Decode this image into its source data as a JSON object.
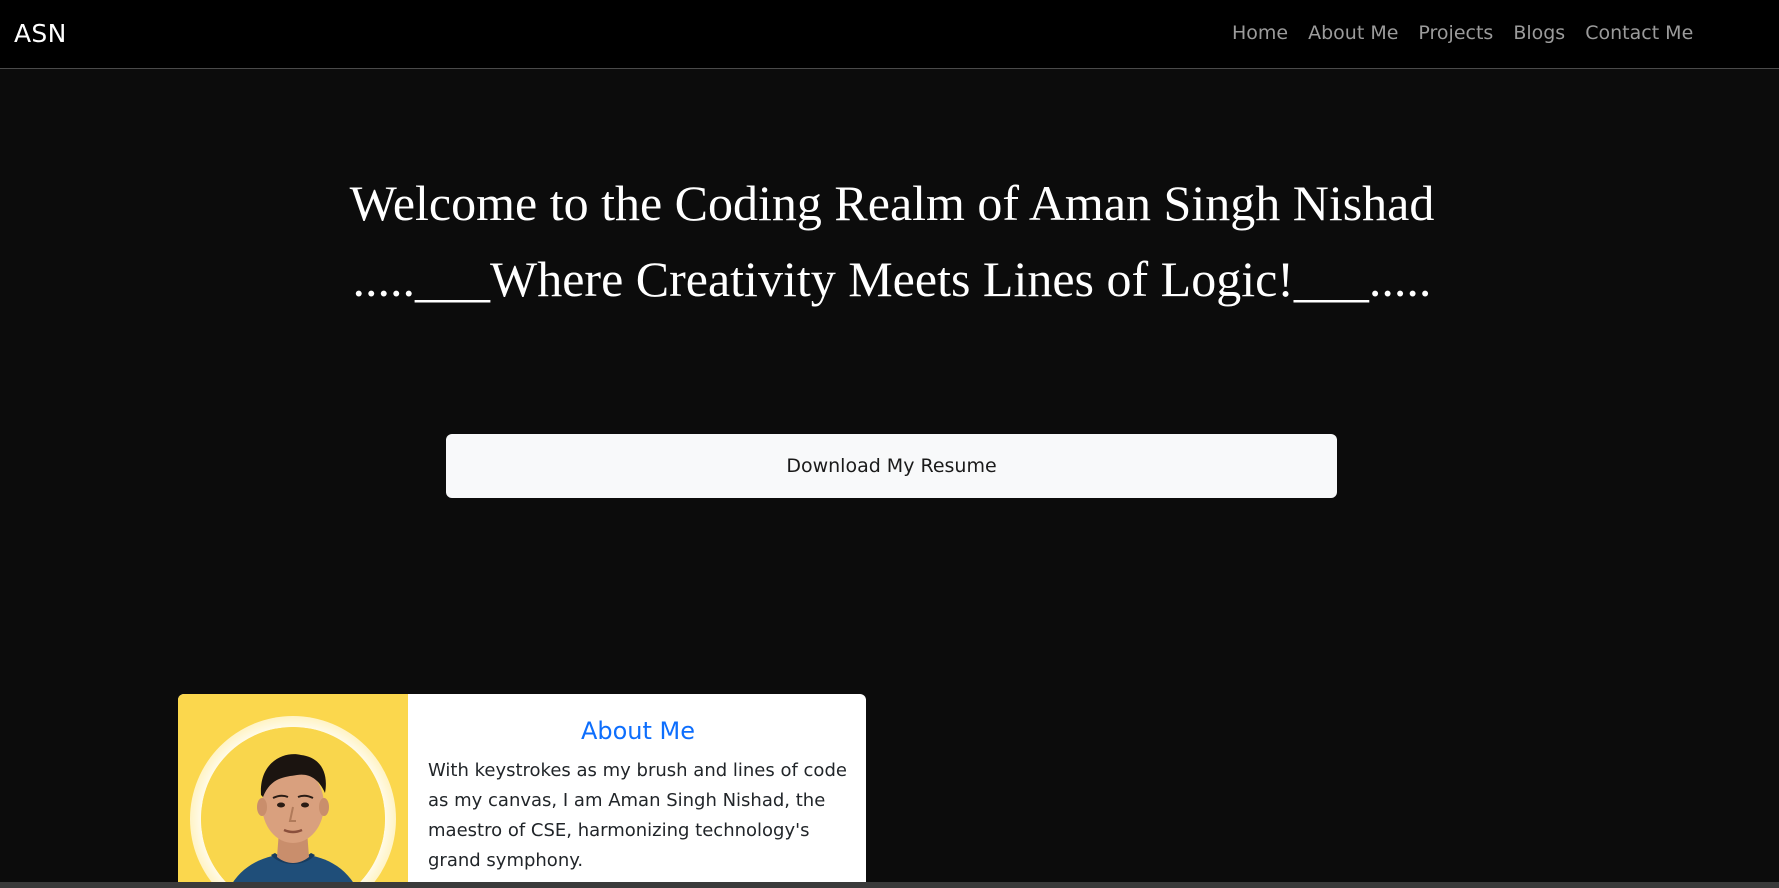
{
  "navbar": {
    "brand": "ASN",
    "links": [
      {
        "label": "Home"
      },
      {
        "label": "About Me"
      },
      {
        "label": "Projects"
      },
      {
        "label": "Blogs"
      },
      {
        "label": "Contact Me"
      }
    ]
  },
  "hero": {
    "line1": "Welcome to the Coding Realm of Aman Singh Nishad",
    "line2": ".....___Where Creativity Meets Lines of Logic!___.....",
    "resume_button": "Download My Resume"
  },
  "about": {
    "heading": "About Me",
    "paragraph": "With keystrokes as my brush and lines of code as my canvas, I am Aman Singh Nishad, the maestro of CSE, harmonizing technology's grand symphony."
  },
  "colors": {
    "navbar_bg": "#000000",
    "page_bg": "#0c0c0c",
    "nav_link": "#9b9b9b",
    "accent_blue": "#0d6efd",
    "photo_panel": "#fbd74d"
  }
}
